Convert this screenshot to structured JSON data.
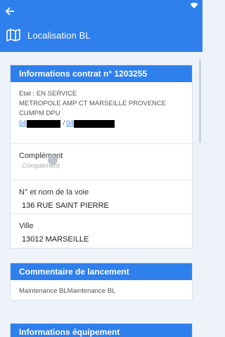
{
  "appbar": {
    "title": "Localisation BL",
    "back_icon": "arrow-left-icon",
    "page_icon": "map-icon",
    "status_icon": "wifi-icon",
    "color": "#2f80ed"
  },
  "contract_card": {
    "header": "Informations contrat n° 1203255",
    "etat": "Etat : EN SERVICE",
    "line2": "METROPOLE AMP CT MARSEILLE PROVENCE",
    "line3": "CUMPM DPU",
    "phone1_prefix": "04",
    "phone_separator": "/",
    "phone2_prefix": "04",
    "complement_label": "Complément",
    "complement_placeholder": "Complément",
    "voie_label": "N° et nom de la voie",
    "voie_value": "136 RUE SAINT PIERRE",
    "ville_label": "Ville",
    "ville_value": "13012 MARSEILLE"
  },
  "launch_card": {
    "header": "Commentaire de lancement",
    "body": "Maintenance BLMaintenance BL"
  },
  "equipment_card": {
    "header": "Informations équipement"
  }
}
